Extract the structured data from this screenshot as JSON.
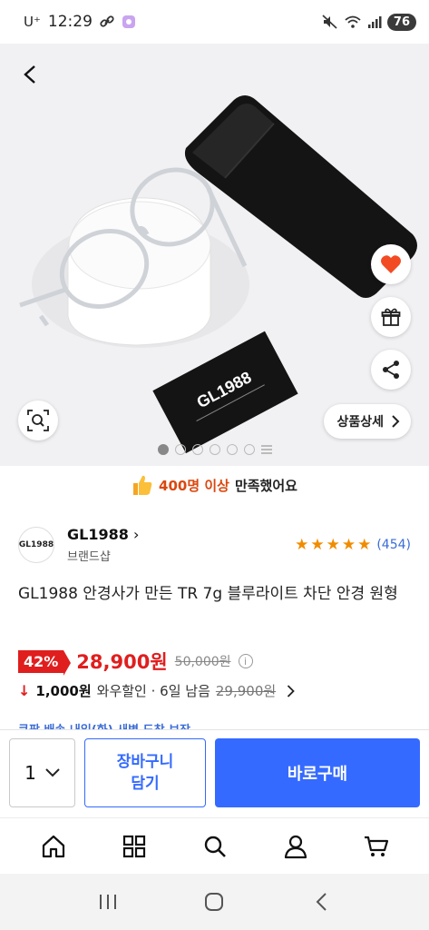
{
  "status_bar": {
    "carrier": "U⁺",
    "time": "12:29",
    "battery": "76",
    "icons": [
      "link-icon",
      "notification-app-icon",
      "mute-icon",
      "wifi-icon",
      "signal-icon"
    ]
  },
  "hero": {
    "image_label": "GL1988",
    "dots_total": 6,
    "dot_active_index": 0,
    "detail_button": "상품상세",
    "icons": [
      "back-arrow-icon",
      "heart-icon",
      "gift-icon",
      "share-icon",
      "zoom-search-icon",
      "chevron-right-icon"
    ]
  },
  "satisfaction": {
    "count": "400명 이상",
    "rest": "만족했어요",
    "icon": "thumbs-up-icon"
  },
  "brand": {
    "logo_text": "GL1988",
    "name": "GL1988",
    "sub": "브랜드샵",
    "rating_stars": 5,
    "review_count": "(454)"
  },
  "product": {
    "title": "GL1988 안경사가 만든 TR 7g 블루라이트 차단 안경 원형"
  },
  "price": {
    "discount": "42%",
    "sale_price": "28,900원",
    "original_price": "50,000원"
  },
  "coupon": {
    "amount": "1,000원",
    "desc": "와우할인 · 6일 남음",
    "strike_price": "29,900원"
  },
  "delivery_peek": {
    "text": "쿠팡 배송 내일(화) 새벽 도착 보장"
  },
  "purchase": {
    "quantity": "1",
    "cart_line1": "장바구니",
    "cart_line2": "담기",
    "buy": "바로구매"
  },
  "bottom_nav": [
    "home-icon",
    "category-grid-icon",
    "search-icon",
    "my-account-icon",
    "cart-icon"
  ],
  "colors": {
    "accent_blue": "#346aff",
    "sale_red": "#e01e1e",
    "orange": "#d9480f",
    "star": "#f08c00"
  }
}
